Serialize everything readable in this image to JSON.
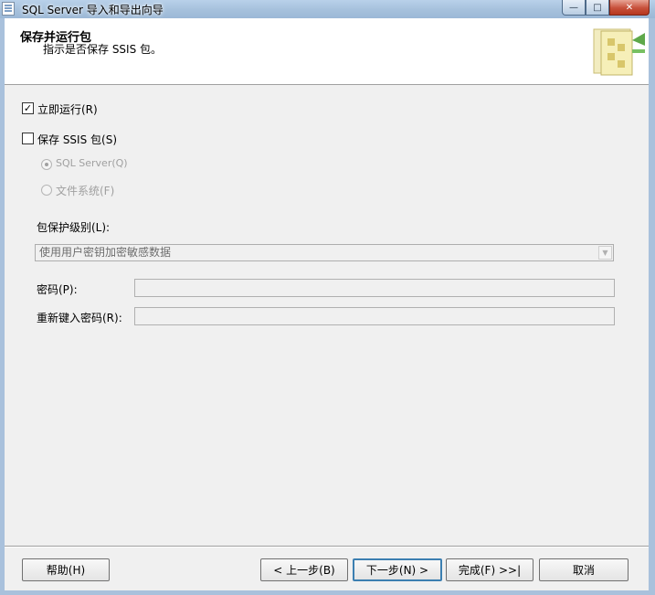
{
  "window": {
    "title": "SQL Server 导入和导出向导",
    "minimize": "—",
    "maximize": "□",
    "close": "✕"
  },
  "header": {
    "title": "保存并运行包",
    "subtitle": "指示是否保存 SSIS 包。",
    "icon": "wizard-package-icon"
  },
  "options": {
    "run_now_label": "立即运行(R)",
    "run_now_checked": true,
    "save_ssis_label": "保存 SSIS 包(S)",
    "save_ssis_checked": false,
    "sql_server_label": "SQL Server(Q)",
    "sql_server_selected": true,
    "file_system_label": "文件系统(F)",
    "file_system_selected": false
  },
  "protection": {
    "label": "包保护级别(L):",
    "selected_value": "使用用户密钥加密敏感数据"
  },
  "password": {
    "label": "密码(P):",
    "value": ""
  },
  "retype_password": {
    "label": "重新键入密码(R):",
    "value": ""
  },
  "buttons": {
    "help": "帮助(H)",
    "back": "< 上一步(B)",
    "next": "下一步(N) >",
    "finish": "完成(F) >>|",
    "cancel": "取消"
  },
  "colors": {
    "disabled_text": "#a0a0a0",
    "title_bar": "#a7c2dd",
    "close_button": "#c7503a"
  }
}
